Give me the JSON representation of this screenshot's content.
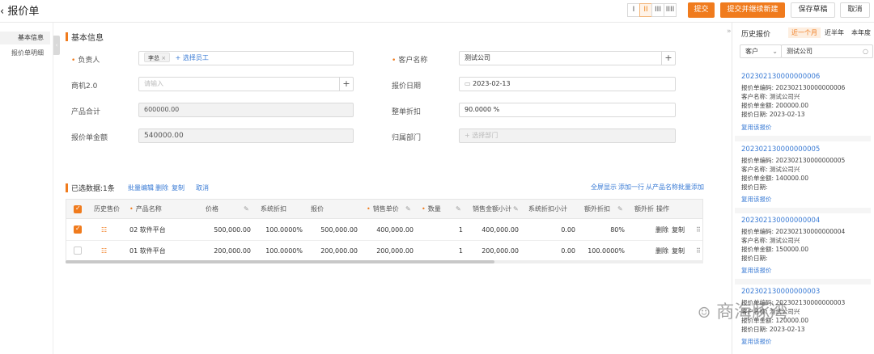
{
  "header": {
    "title": "报价单",
    "view_buttons": [
      "I",
      "II",
      "III",
      "IIII"
    ],
    "active_view": 1,
    "buttons": {
      "submit": "提交",
      "submit_new": "提交并继续新建",
      "save_draft": "保存草稿",
      "cancel": "取消"
    }
  },
  "sidebar": {
    "items": [
      {
        "label": "基本信息",
        "active": true
      },
      {
        "label": "报价单明细",
        "active": false
      }
    ]
  },
  "basic_info": {
    "title": "基本信息",
    "owner": {
      "label": "负责人",
      "tag": "李总",
      "tag_close": "×",
      "add_link": "+ 选择员工"
    },
    "customer": {
      "label": "客户名称",
      "value": "测试公司"
    },
    "opportunity": {
      "label": "商机2.0",
      "placeholder": "请输入"
    },
    "quote_date": {
      "label": "报价日期",
      "value": "2023-02-13"
    },
    "product_total": {
      "label": "产品合计",
      "value": "600000.00"
    },
    "discount": {
      "label": "整单折扣",
      "value": "90.0000",
      "unit": "%"
    },
    "quote_amount": {
      "label": "报价单金额",
      "value": "540000.00"
    },
    "department": {
      "label": "归属部门",
      "placeholder": "+ 选择部门"
    }
  },
  "detail": {
    "selected_label": "已选数据:1条",
    "actions": [
      "批量编辑",
      "删除",
      "复制",
      "取消"
    ],
    "right_actions": [
      "全屏显示",
      "添加一行",
      "从产品名称批量添加"
    ],
    "columns": [
      "历史售价",
      "产品名称",
      "价格",
      "系统折扣",
      "报价",
      "销售单价",
      "数量",
      "销售金额小计",
      "系统折扣小计",
      "额外折扣",
      "额外折",
      "操作"
    ],
    "rows": [
      {
        "checked": true,
        "product": "02 软件平台",
        "price": "500,000.00",
        "sys_discount": "100.0000%",
        "quote": "500,000.00",
        "unit_price": "400,000.00",
        "qty": "1",
        "subtotal": "400,000.00",
        "sys_disc_sub": "0.00",
        "extra_discount": "80%",
        "delete": "删除",
        "copy": "复制"
      },
      {
        "checked": false,
        "product": "01 软件平台",
        "price": "200,000.00",
        "sys_discount": "100.0000%",
        "quote": "200,000.00",
        "unit_price": "200,000.00",
        "qty": "1",
        "subtotal": "200,000.00",
        "sys_disc_sub": "0.00",
        "extra_discount": "100.0000%",
        "delete": "删除",
        "copy": "复制"
      }
    ]
  },
  "history": {
    "title": "历史报价",
    "tabs": [
      "近一个月",
      "近半年",
      "本年度"
    ],
    "filter_field": "客户",
    "filter_value": "测试公司",
    "reuse_label": "复用该报价",
    "cards": [
      {
        "no": "202302130000000006",
        "code": "报价单编码: 202302130000000006",
        "customer": "客户名称: 测试公司兴",
        "amount": "报价单金额: 200000.00",
        "date": "报价日期: 2023-02-13"
      },
      {
        "no": "202302130000000005",
        "code": "报价单编码: 202302130000000005",
        "customer": "客户名称: 测试公司兴",
        "amount": "报价单金额: 140000.00",
        "date": "报价日期:"
      },
      {
        "no": "202302130000000004",
        "code": "报价单编码: 202302130000000004",
        "customer": "客户名称: 测试公司兴",
        "amount": "报价单金额: 150000.00",
        "date": "报价日期:"
      },
      {
        "no": "202302130000000003",
        "code": "报价单编码: 202302130000000003",
        "customer": "客户名称: 测试公司兴",
        "amount": "报价单金额: 120000.00",
        "date": "报价日期: 2023-02-13"
      }
    ]
  },
  "watermark": "商海豚湾",
  "colors": {
    "accent": "#f07b1d",
    "link": "#3a7bd5"
  }
}
